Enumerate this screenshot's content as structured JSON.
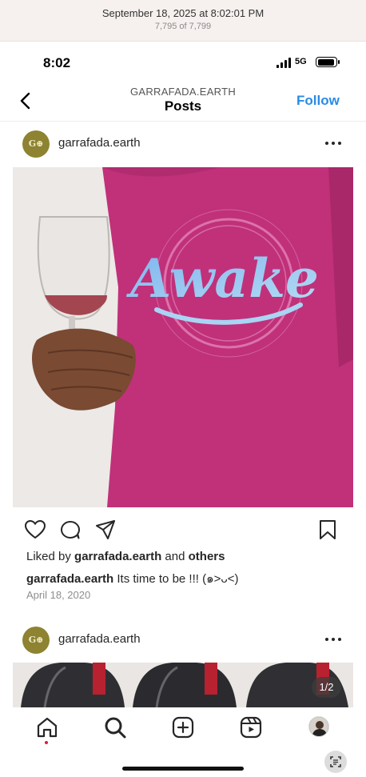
{
  "viewer": {
    "date": "September 18, 2025 at 8:02:01 PM",
    "count": "7,795 of 7,799"
  },
  "status_bar": {
    "time": "8:02",
    "network": "5G"
  },
  "header": {
    "account": "GARRAFADA.EARTH",
    "title": "Posts",
    "follow_label": "Follow"
  },
  "post1": {
    "username": "garrafada.earth",
    "avatar_text": "G⊕",
    "image_text": "Awake",
    "liked_prefix": "Liked by ",
    "liked_user": "garrafada.earth",
    "liked_mid": " and ",
    "liked_others": "others",
    "caption_user": "garrafada.earth",
    "caption_text": " Its time to be !!! (๑˃ᴗ˂)",
    "date": "April 18, 2020"
  },
  "post2": {
    "username": "garrafada.earth",
    "avatar_text": "G⊕",
    "counter": "1/2"
  },
  "nav": {
    "items": [
      "home-icon",
      "search-icon",
      "create-icon",
      "reels-icon",
      "profile-avatar"
    ]
  },
  "colors": {
    "accent": "#2a8be5",
    "shirt": "#c8327a",
    "print": "#8ec5f0",
    "logo": "#8d8330",
    "notification": "#e3173e"
  }
}
